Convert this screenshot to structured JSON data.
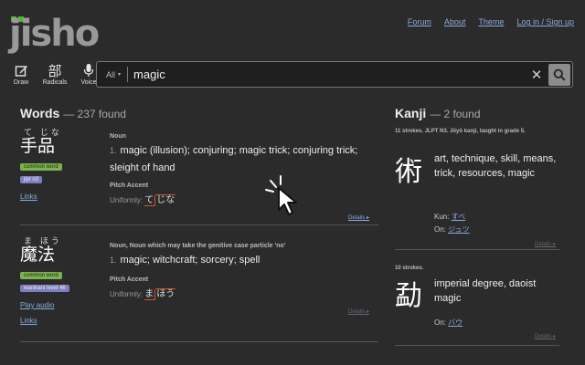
{
  "header": {
    "logo": "jisho",
    "nav": [
      "Forum",
      "About",
      "Theme",
      "Log in / Sign up"
    ]
  },
  "tools": [
    {
      "icon": "pencil-icon",
      "label": "Draw"
    },
    {
      "icon": "radicals-icon",
      "glyph": "部",
      "label": "Radicals"
    },
    {
      "icon": "microphone-icon",
      "label": "Voice"
    }
  ],
  "search": {
    "scope": "All",
    "query": "magic"
  },
  "words": {
    "title": "Words",
    "count": "— 237 found",
    "entries": [
      {
        "furigana": "て じな",
        "word": "手品",
        "badges": [
          "common word",
          "jlpt n3"
        ],
        "links": [
          "Links"
        ],
        "pos": "Noun",
        "meaning_num": "1.",
        "meaning": "magic (illusion); conjuring; magic trick; conjuring trick; sleight of hand",
        "pitch_label": "Pitch Accent",
        "pitch_prefix": "Uniformly:",
        "pitch_m1": "て",
        "pitch_m2": "じな",
        "details": "Details ▸"
      },
      {
        "furigana": "ま ほう",
        "word": "魔法",
        "badges": [
          "common word",
          "wanikani level 46"
        ],
        "links": [
          "Play audio",
          "Links"
        ],
        "pos": "Noun, Noun which may take the genitive case particle 'no'",
        "meaning_num": "1.",
        "meaning": "magic; witchcraft; sorcery; spell",
        "pitch_label": "Pitch Accent",
        "pitch_prefix": "Uniformly:",
        "pitch_m1": "ま",
        "pitch_m2": "ほう",
        "details": "Details ▸"
      }
    ]
  },
  "kanji": {
    "title": "Kanji",
    "count": "— 2 found",
    "cards": [
      {
        "info": "11 strokes. JLPT N3. Jōyō kanji, taught in grade 5.",
        "char": "術",
        "meaning": "art, technique, skill, means, trick, resources, magic",
        "kun_label": "Kun:",
        "kun": "すべ",
        "on_label": "On:",
        "on": "ジュツ",
        "details": "Details ▸"
      },
      {
        "info": "10 strokes.",
        "char": "勐",
        "meaning": "imperial degree, daoist magic",
        "on_label": "On:",
        "on": "バウ",
        "details": "Details ▸"
      }
    ]
  }
}
